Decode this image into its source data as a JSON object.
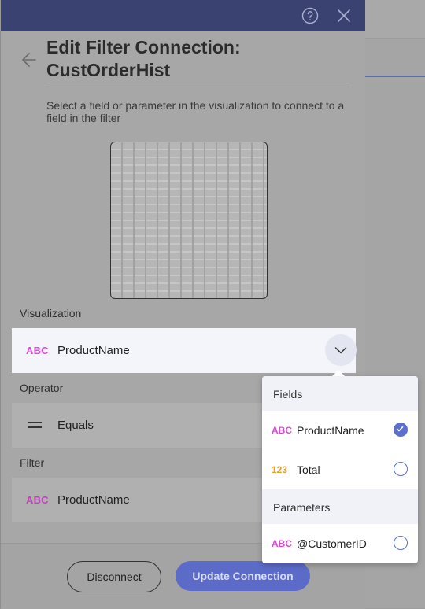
{
  "dialog": {
    "title": "Edit Filter Connection: CustOrderHist",
    "description": "Select a field or parameter in the visualization to connect to a field in the filter",
    "help_icon": "help-circle-icon",
    "close_icon": "close-icon",
    "back_icon": "arrow-left-icon"
  },
  "visualization": {
    "label": "Visualization",
    "type": "ABC",
    "value": "ProductName"
  },
  "operator": {
    "label": "Operator",
    "value": "Equals",
    "icon": "equals-icon"
  },
  "filter": {
    "label": "Filter",
    "type": "ABC",
    "value": "ProductName"
  },
  "footer": {
    "disconnect_label": "Disconnect",
    "update_label": "Update Connection"
  },
  "dropdown": {
    "fields_header": "Fields",
    "fields": [
      {
        "type": "ABC",
        "name": "ProductName",
        "selected": true
      },
      {
        "type": "123",
        "name": "Total",
        "selected": false
      }
    ],
    "parameters_header": "Parameters",
    "parameters": [
      {
        "type": "ABC",
        "name": "@CustomerID",
        "selected": false
      }
    ]
  },
  "colors": {
    "titlebar": "#3a4272",
    "accent": "#5b6fd1",
    "text_type": "#e048d8",
    "number_type": "#e2a12a"
  }
}
